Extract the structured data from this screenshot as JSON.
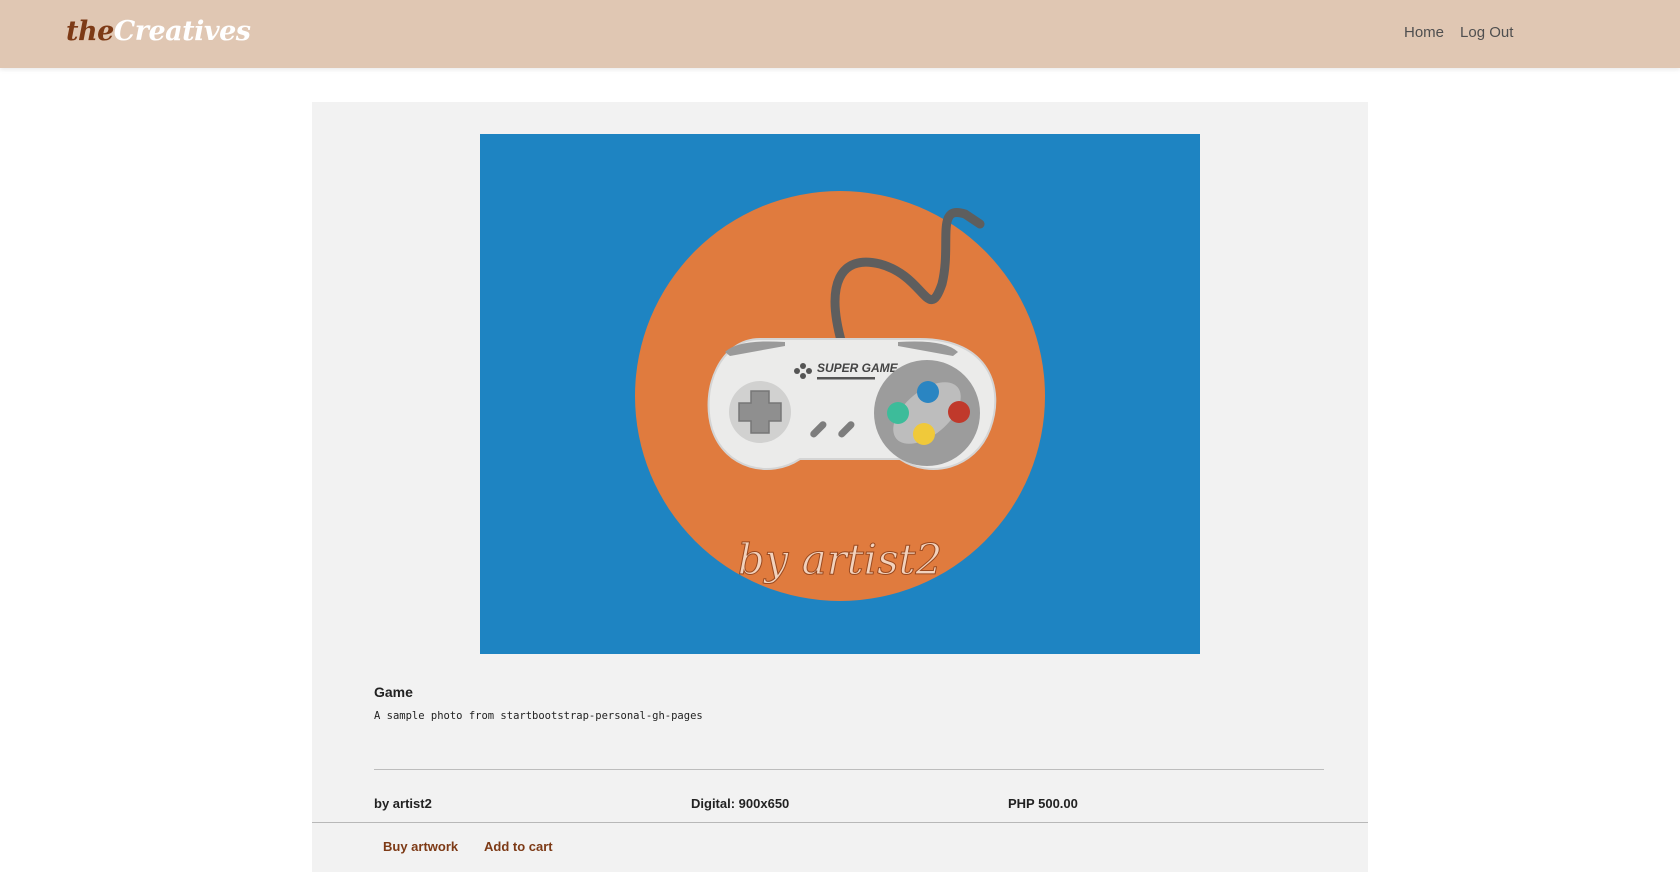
{
  "navbar": {
    "brand_part1": "the",
    "brand_part2": "Creatives",
    "links": [
      "Home",
      "Log Out"
    ]
  },
  "artwork": {
    "image_title": "SUPER GAME",
    "watermark": "by artist2",
    "background_color": "#1e84c2",
    "circle_color": "#e07b3e"
  },
  "card": {
    "title": "Game",
    "description": "A sample photo from startbootstrap-personal-gh-pages",
    "artist": "by artist2",
    "format": "Digital: 900x650",
    "price": "PHP 500.00"
  },
  "actions": {
    "buy_label": "Buy artwork",
    "cart_label": "Add to cart"
  },
  "colors": {
    "navbar_bg": "#e0c7b3",
    "brand_accent": "#7d3a16",
    "card_bg": "#f2f2f2"
  }
}
